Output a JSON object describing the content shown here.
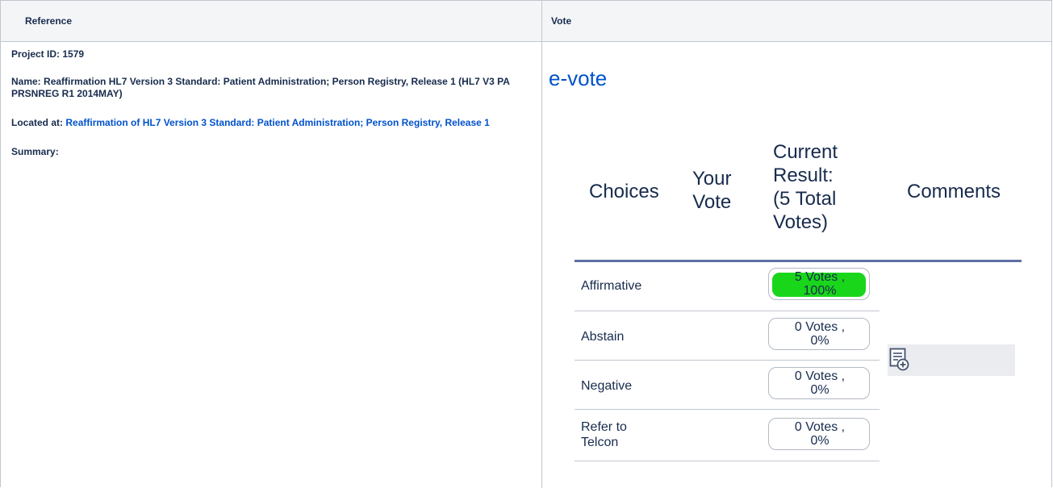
{
  "table": {
    "headers": [
      "Reference",
      "Vote"
    ]
  },
  "reference": {
    "project_id_label": "Project ID:",
    "project_id": "1579",
    "name_label": "Name:",
    "name": "Reaffirmation HL7 Version 3 Standard: Patient Administration; Person Registry, Release 1 (HL7 V3 PA PRSNREG R1 2014MAY)",
    "located_label": "Located at:",
    "located_link": "Reaffirmation of HL7 Version 3 Standard: Patient Administration; Person Registry, Release 1",
    "summary_label": "Summary:"
  },
  "evote": {
    "title": "e-vote",
    "headers": {
      "choices": "Choices",
      "your_vote_line1": "Your",
      "your_vote_line2": "Vote",
      "result_line1": "Current",
      "result_line2": "Result:",
      "result_line3": "(5 Total",
      "result_line4": "Votes)",
      "comments": "Comments"
    },
    "rows": [
      {
        "choice_line1": "Affirmative",
        "choice_line2": "",
        "result_line1": "5 Votes ,",
        "result_line2": "100%",
        "fraction": 1.0
      },
      {
        "choice_line1": "Abstain",
        "choice_line2": "",
        "result_line1": "0 Votes ,",
        "result_line2": "0%",
        "fraction": 0
      },
      {
        "choice_line1": "Negative",
        "choice_line2": "",
        "result_line1": "0 Votes ,",
        "result_line2": "0%",
        "fraction": 0
      },
      {
        "choice_line1": "Refer to",
        "choice_line2": "Telcon",
        "result_line1": "0 Votes ,",
        "result_line2": "0%",
        "fraction": 0
      }
    ],
    "bar_color": "#1ad61a",
    "comment_icon": "add-comment-icon"
  }
}
